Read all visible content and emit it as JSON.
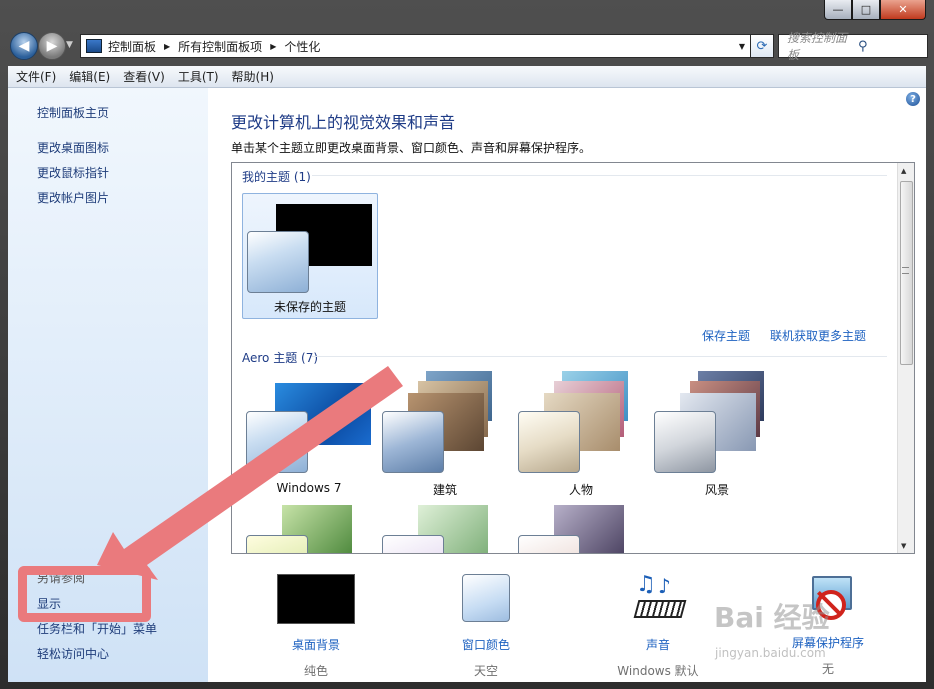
{
  "window": {
    "min": "—",
    "max": "□",
    "close": "✕"
  },
  "address": {
    "crumbs": [
      "控制面板",
      "所有控制面板项",
      "个性化"
    ],
    "search_placeholder": "搜索控制面板"
  },
  "menu": [
    "文件(F)",
    "编辑(E)",
    "查看(V)",
    "工具(T)",
    "帮助(H)"
  ],
  "sidebar": {
    "top_links": [
      "控制面板主页",
      "更改桌面图标",
      "更改鼠标指针",
      "更改帐户图片"
    ],
    "see_also": "另请参阅",
    "bottom_links": [
      "显示",
      "任务栏和「开始」菜单",
      "轻松访问中心"
    ]
  },
  "content": {
    "title": "更改计算机上的视觉效果和声音",
    "subtitle": "单击某个主题立即更改桌面背景、窗口颜色、声音和屏幕保护程序。",
    "my_themes_header": "我的主题 (1)",
    "unsaved_theme": "未保存的主题",
    "save_theme": "保存主题",
    "get_more": "联机获取更多主题",
    "aero_header": "Aero 主题 (7)",
    "aero_themes": [
      "Windows 7",
      "建筑",
      "人物",
      "风景"
    ]
  },
  "bottom_bar": [
    {
      "label": "桌面背景",
      "value": "纯色",
      "icon": "desktop-background-icon"
    },
    {
      "label": "窗口颜色",
      "value": "天空",
      "icon": "window-color-icon"
    },
    {
      "label": "声音",
      "value": "Windows 默认",
      "icon": "sound-icon"
    },
    {
      "label": "屏幕保护程序",
      "value": "无",
      "icon": "screensaver-icon"
    }
  ],
  "overlay": {
    "watermark": "Bai 经验",
    "watermark_url": "jingyan.baidu.com"
  },
  "colors": {
    "accent": "#1e62c0",
    "heading": "#1e3b86",
    "annotation": "#ea7a7d"
  }
}
